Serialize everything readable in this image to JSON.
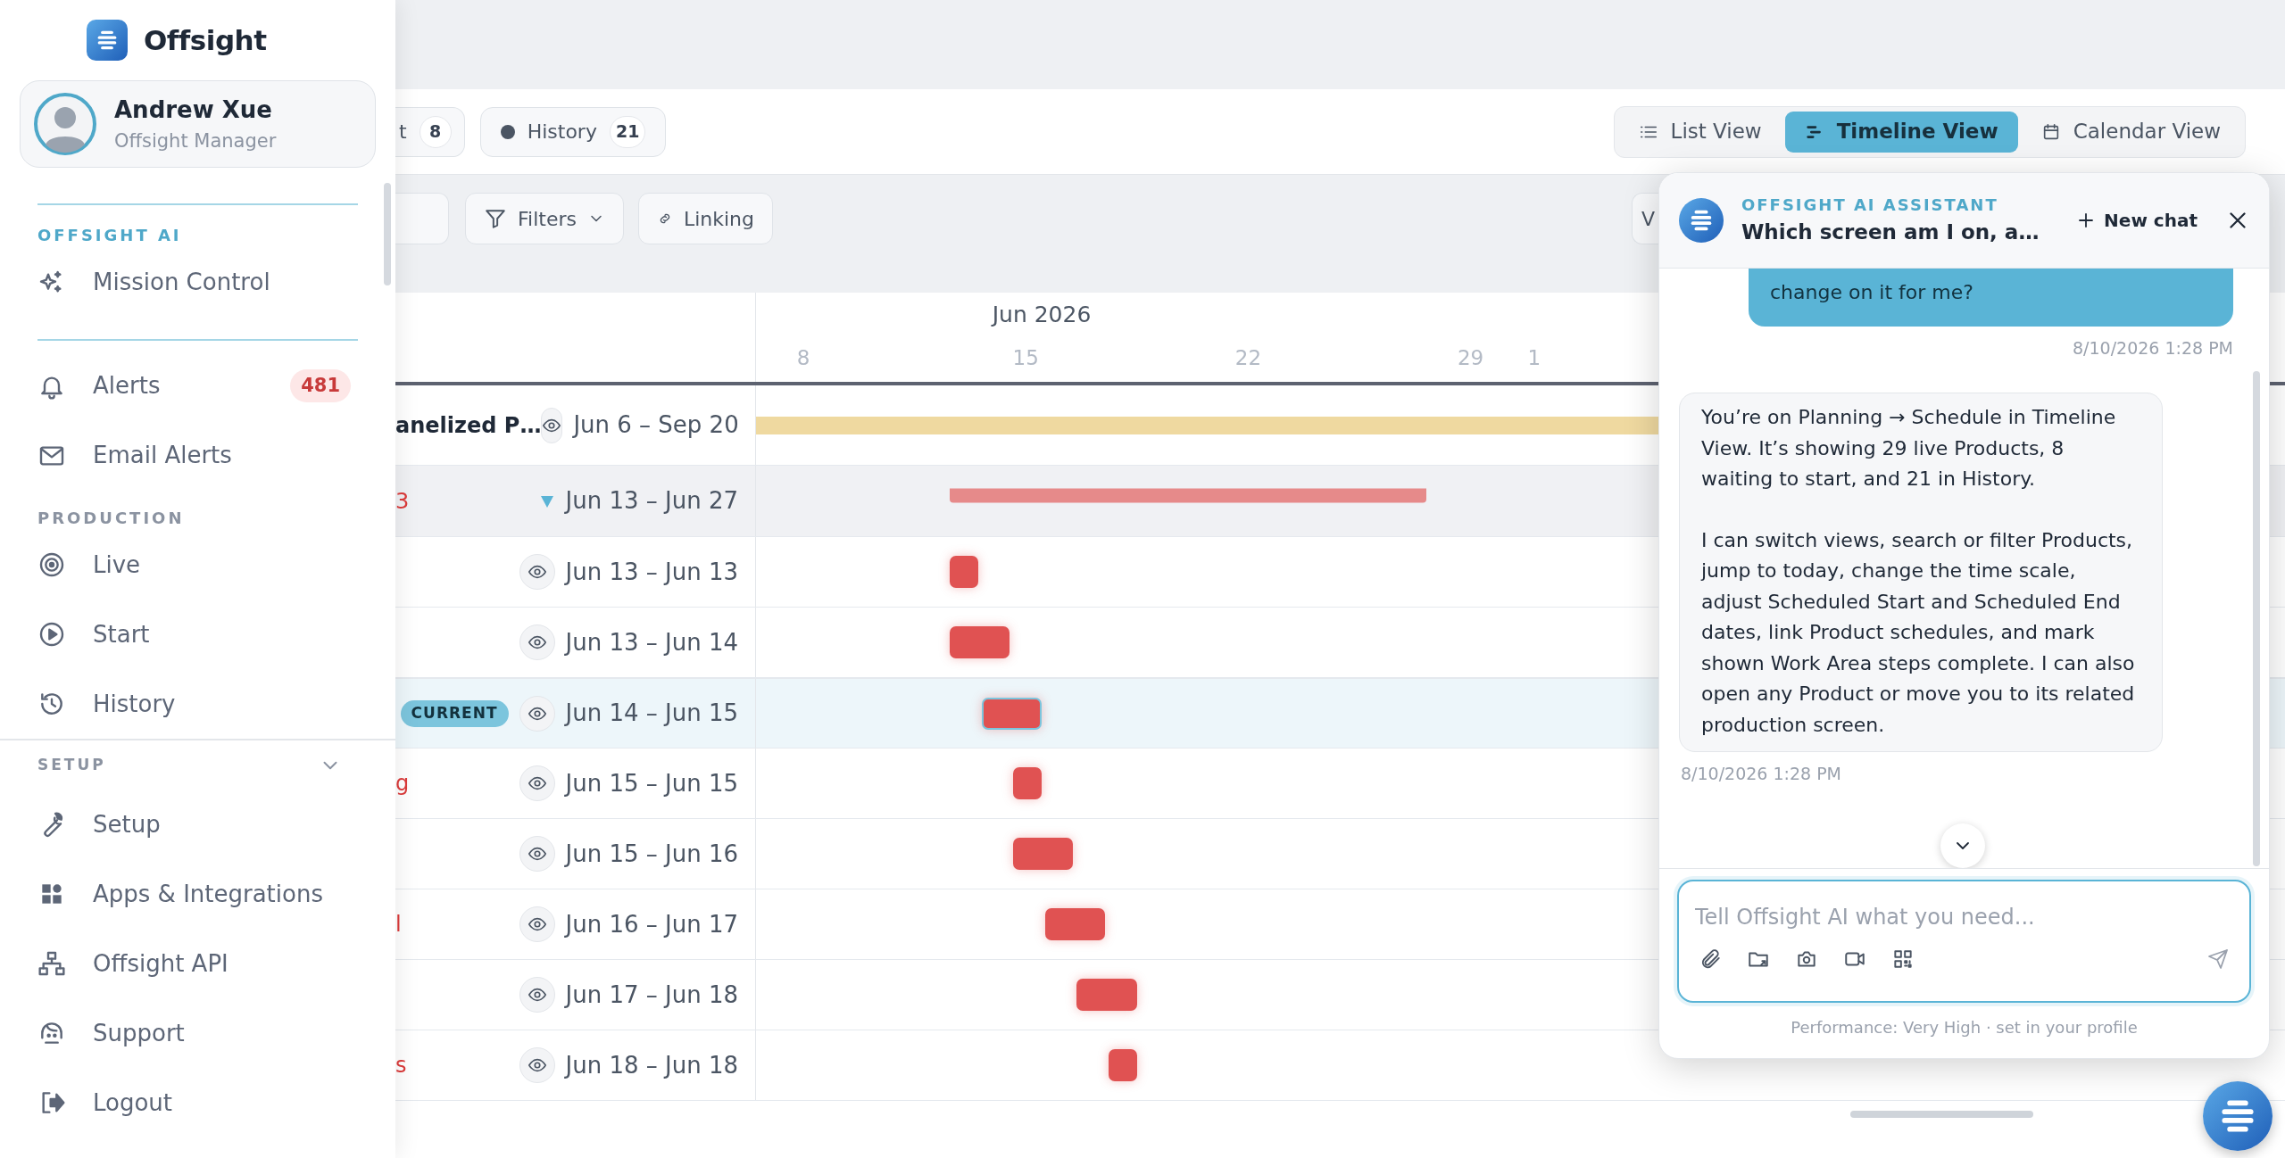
{
  "app": {
    "name": "Offsight"
  },
  "user": {
    "name": "Andrew Xue",
    "role": "Offsight Manager"
  },
  "sidebar": {
    "sections": [
      {
        "kind": "ai",
        "title": "OFFSIGHT AI",
        "items": [
          {
            "label": "Mission Control"
          }
        ]
      },
      {
        "kind": "plain",
        "items": [
          {
            "label": "Alerts",
            "badge": "481"
          },
          {
            "label": "Email Alerts"
          }
        ]
      },
      {
        "kind": "plain",
        "title": "PRODUCTION",
        "items": [
          {
            "label": "Live"
          },
          {
            "label": "Start"
          },
          {
            "label": "History"
          }
        ]
      }
    ]
  },
  "setup": {
    "title": "SETUP",
    "expanded": true,
    "items": [
      {
        "label": "Setup"
      },
      {
        "label": "Apps & Integrations"
      },
      {
        "label": "Offsight API"
      },
      {
        "label": "Support"
      },
      {
        "label": "Logout"
      }
    ]
  },
  "status_tabs": [
    {
      "kind": "plain",
      "label": "t",
      "count": "8"
    },
    {
      "kind": "dot",
      "label": "History",
      "count": "21"
    }
  ],
  "views": [
    {
      "label": "List View",
      "selected": false
    },
    {
      "label": "Timeline View",
      "selected": true
    },
    {
      "label": "Calendar View",
      "selected": false
    }
  ],
  "toolbar": {
    "buttons": [
      {
        "kind": "dropdown",
        "label": "Filters"
      },
      {
        "kind": "link",
        "label": "Linking"
      },
      {
        "kind": "plain",
        "label": "V"
      }
    ]
  },
  "timeline": {
    "month": "Jun 2026",
    "ticks": [
      "8",
      "15",
      "22",
      "29",
      "1"
    ],
    "rows": [
      {
        "kind": "project",
        "name": "anelized P…",
        "dates": "Jun 6 – Sep 20"
      },
      {
        "kind": "group",
        "name": "3",
        "expanded": true,
        "dates": "Jun 13 – Jun 27"
      },
      {
        "kind": "step",
        "current": false,
        "dates": "Jun 13 – Jun 13"
      },
      {
        "kind": "step",
        "current": false,
        "dates": "Jun 13 – Jun 14"
      },
      {
        "kind": "step",
        "current": true,
        "badge": "CURRENT",
        "dates": "Jun 14 – Jun 15"
      },
      {
        "kind": "step",
        "current": false,
        "name": "g",
        "dates": "Jun 15 – Jun 15"
      },
      {
        "kind": "step",
        "current": false,
        "dates": "Jun 15 – Jun 16"
      },
      {
        "kind": "step",
        "current": false,
        "name": "l",
        "dates": "Jun 16 – Jun 17"
      },
      {
        "kind": "step",
        "current": false,
        "dates": "Jun 17 – Jun 18"
      },
      {
        "kind": "step",
        "current": false,
        "name": "s",
        "dates": "Jun 18 – Jun 18"
      }
    ]
  },
  "chat": {
    "label": "OFFSIGHT AI ASSISTANT",
    "title": "Which screen am I on, a…",
    "new_chat": "New chat",
    "messages": [
      {
        "kind": "user",
        "paragraphs": [
          "change on it for me?"
        ],
        "time": "8/10/2026 1:28 PM"
      },
      {
        "kind": "assistant",
        "paragraphs": [
          "You’re on Planning → Schedule in Timeline View. It’s showing 29 live Products, 8 waiting to start, and 21 in History.",
          "I can switch views, search or filter Products, jump to today, change the time scale, adjust Scheduled Start and Scheduled End dates, link Product schedules, and mark shown Work Area steps complete. I can also open any Product or move you to its related production screen."
        ],
        "time": "8/10/2026 1:28 PM"
      }
    ],
    "placeholder": "Tell Offsight AI what you need...",
    "footer": "Performance: Very High · set in your profile"
  }
}
